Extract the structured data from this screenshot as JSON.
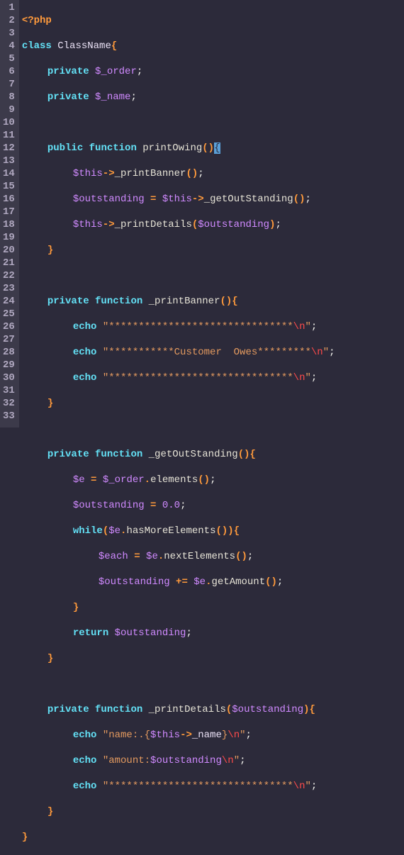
{
  "editor": {
    "line_count": 33,
    "language": "php",
    "code": {
      "l1": "<?php",
      "l2_kw1": "class",
      "l2_name": "ClassName",
      "l3_kw": "private",
      "l3_var": "$_order",
      "l4_kw": "private",
      "l4_var": "$_name",
      "l6_kw1": "public",
      "l6_kw2": "function",
      "l6_fn": "printOwing",
      "l7_var": "$this",
      "l7_fn": "_printBanner",
      "l8_var1": "$outstanding",
      "l8_var2": "$this",
      "l8_fn": "_getOutStanding",
      "l9_var": "$this",
      "l9_fn": "_printDetails",
      "l9_arg": "$outstanding",
      "l12_kw1": "private",
      "l12_kw2": "function",
      "l12_fn": "_printBanner",
      "l13_kw": "echo",
      "l13_str": "\"*******************************",
      "l13_esc": "\\n",
      "l13_end": "\"",
      "l14_kw": "echo",
      "l14_str": "\"***********Customer  Owes*********",
      "l14_esc": "\\n",
      "l14_end": "\"",
      "l15_kw": "echo",
      "l15_str": "\"*******************************",
      "l15_esc": "\\n",
      "l15_end": "\"",
      "l18_kw1": "private",
      "l18_kw2": "function",
      "l18_fn": "_getOutStanding",
      "l19_var1": "$e",
      "l19_var2": "$_order",
      "l19_fn": "elements",
      "l20_var": "$outstanding",
      "l20_num": "0.0",
      "l21_kw": "while",
      "l21_var": "$e",
      "l21_fn": "hasMoreElements",
      "l22_var1": "$each",
      "l22_var2": "$e",
      "l22_fn": "nextElements",
      "l23_var1": "$outstanding",
      "l23_var2": "$e",
      "l23_fn": "getAmount",
      "l25_kw": "return",
      "l25_var": "$outstanding",
      "l28_kw1": "private",
      "l28_kw2": "function",
      "l28_fn": "_printDetails",
      "l28_arg": "$outstanding",
      "l29_kw": "echo",
      "l29_str1": "\"name:.{",
      "l29_var": "$this",
      "l29_prop": "_name",
      "l29_str2": "}",
      "l29_esc": "\\n",
      "l29_end": "\"",
      "l30_kw": "echo",
      "l30_str1": "\"amount:",
      "l30_var": "$outstanding",
      "l30_esc": "\\n",
      "l30_end": "\"",
      "l31_kw": "echo",
      "l31_str": "\"*******************************",
      "l31_esc": "\\n",
      "l31_end": "\""
    }
  },
  "chart_data": null
}
